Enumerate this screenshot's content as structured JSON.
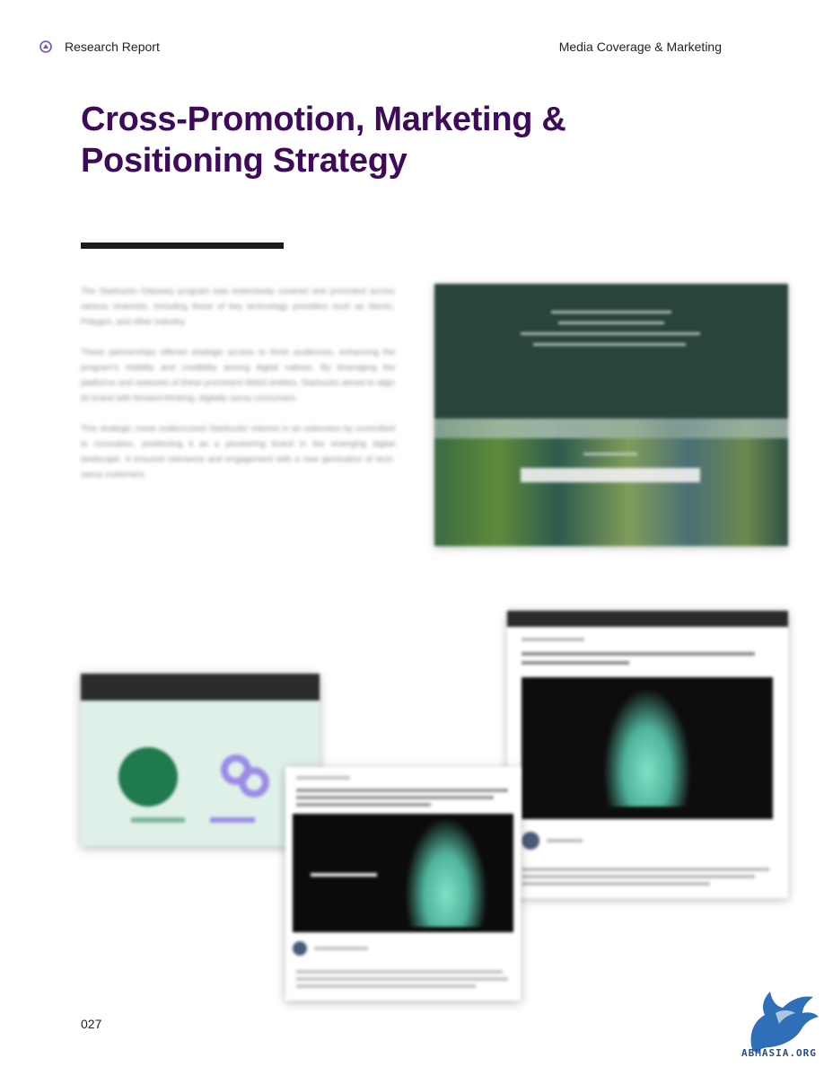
{
  "header": {
    "left_label": "Research Report",
    "right_label": "Media Coverage & Marketing"
  },
  "title": "Cross-Promotion, Marketing & Positioning Strategy",
  "body_paragraphs": [
    "The Starbucks Odyssey program was extensively covered and promoted across various channels, including those of key technology providers such as Nomic, Polygon, and other industry.",
    "These partnerships offered strategic access to fresh audiences, enhancing the program's visibility and credibility among digital natives. By leveraging the platforms and networks of these prominent Web3 entities, Starbucks aimed to align its brand with forward-thinking, digitally savvy consumers.",
    "This strategic move underscored Starbucks' interest in an extension by committed to innovation, positioning it as a pioneering brand in the emerging digital landscape. It ensured relevance and engagement with a new generation of tech-savvy customers."
  ],
  "page_number": "027",
  "watermark": {
    "text": "ABMASIA.ORG",
    "icon": "winged-horse-logo"
  },
  "icons": {
    "header_logo": "brand-mark-icon"
  },
  "colors": {
    "title": "#3e0a5a",
    "rule": "#1c1c1c",
    "watermark": "#2a4c8c"
  }
}
